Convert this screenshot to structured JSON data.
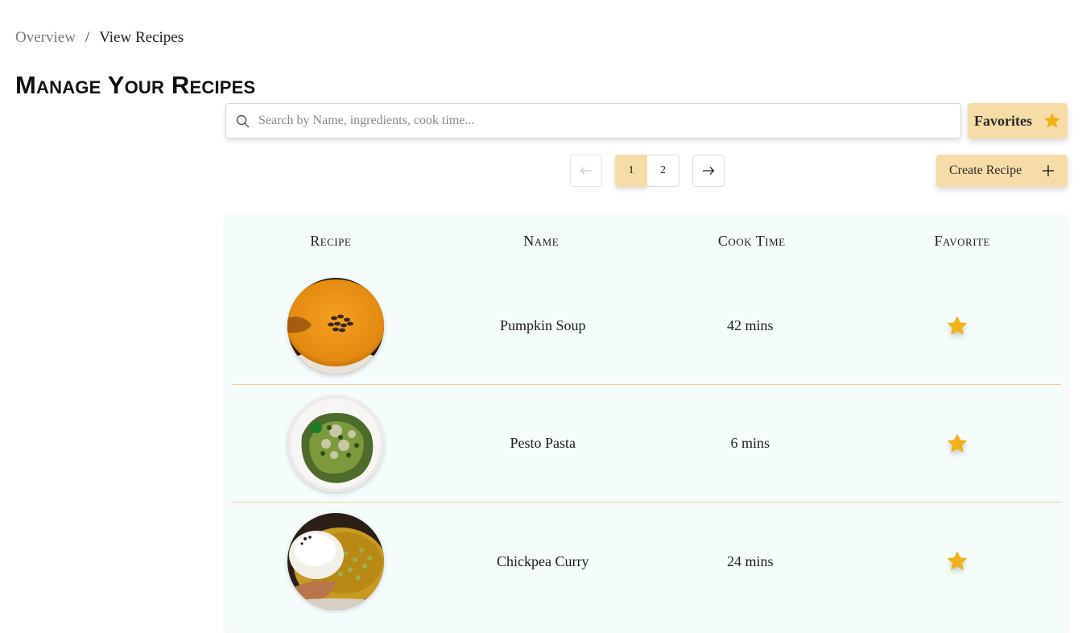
{
  "breadcrumb": {
    "parent": "Overview",
    "separator": "/",
    "current": "View Recipes"
  },
  "page_title": "Manage Your Recipes",
  "search": {
    "placeholder": "Search by Name, ingredients, cook time...",
    "value": ""
  },
  "favorites_button": {
    "label": "Favorites",
    "icon": "star-icon"
  },
  "pagination": {
    "pages": [
      "1",
      "2"
    ],
    "current": "1",
    "prev_icon": "arrow-left-icon",
    "next_icon": "arrow-right-icon"
  },
  "create_button": {
    "label": "Create Recipe",
    "icon": "plus-icon"
  },
  "table": {
    "headers": [
      "Recipe",
      "Name",
      "Cook Time",
      "Favorite"
    ],
    "rows": [
      {
        "image": "pumpkin-soup-image",
        "name": "Pumpkin Soup",
        "cook_time": "42 mins",
        "favorite": true
      },
      {
        "image": "pesto-pasta-image",
        "name": "Pesto Pasta",
        "cook_time": "6 mins",
        "favorite": true
      },
      {
        "image": "chickpea-curry-image",
        "name": "Chickpea Curry",
        "cook_time": "24 mins",
        "favorite": true
      }
    ]
  },
  "colors": {
    "accent": "#f6dca6",
    "star": "#f0b216",
    "table_bg": "#f5fdfc",
    "row_divider": "#f2cf8a"
  }
}
